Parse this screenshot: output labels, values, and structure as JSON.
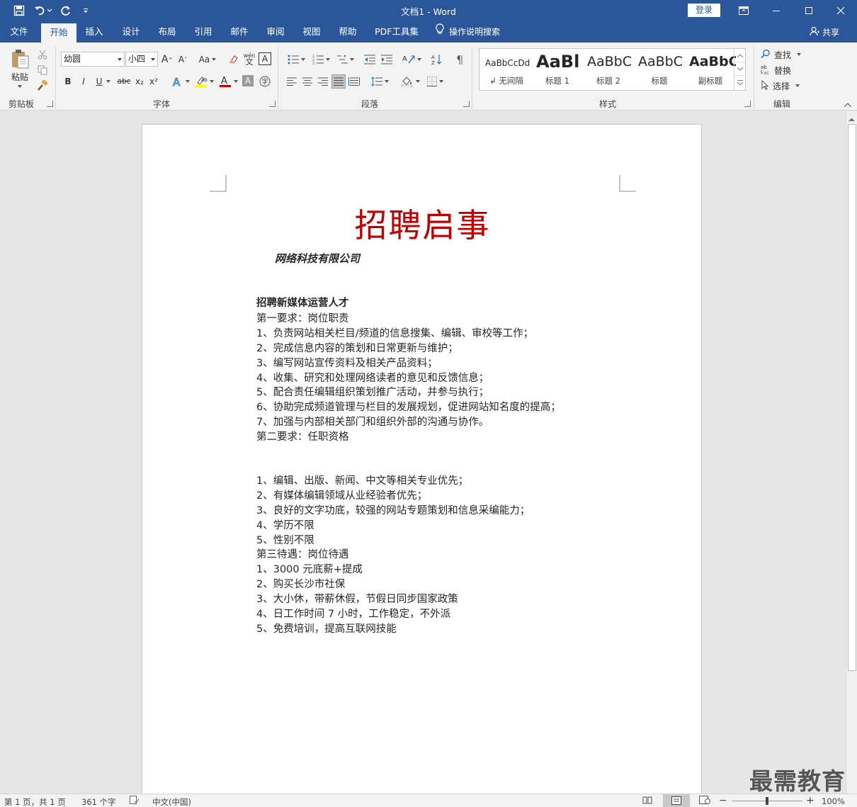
{
  "titlebar": {
    "title": "文档1 - Word",
    "login_label": "登录"
  },
  "tabs": [
    {
      "label": "文件"
    },
    {
      "label": "开始"
    },
    {
      "label": "插入"
    },
    {
      "label": "设计"
    },
    {
      "label": "布局"
    },
    {
      "label": "引用"
    },
    {
      "label": "邮件"
    },
    {
      "label": "审阅"
    },
    {
      "label": "视图"
    },
    {
      "label": "帮助"
    },
    {
      "label": "PDF工具集"
    }
  ],
  "tell_me": "操作说明搜索",
  "share": "共享",
  "ribbon": {
    "clipboard": {
      "paste_label": "粘贴",
      "group_label": "剪贴板"
    },
    "font": {
      "font_name": "幼圆",
      "font_size": "小四",
      "group_label": "字体",
      "bold": "B",
      "italic": "I",
      "underline": "U",
      "strike": "abc",
      "subscript": "x₂",
      "superscript": "x²",
      "grow": "A",
      "shrink": "A",
      "case": "Aa",
      "phonetic": "wén",
      "border_char": "A",
      "shading_char": "A"
    },
    "paragraph": {
      "group_label": "段落"
    },
    "styles": {
      "group_label": "样式",
      "items": [
        {
          "sample": "AaBbCcDd",
          "name": "↲ 无间隔"
        },
        {
          "sample": "AaBl",
          "name": "标题 1"
        },
        {
          "sample": "AaBbC",
          "name": "标题 2"
        },
        {
          "sample": "AaBbC",
          "name": "标题"
        },
        {
          "sample": "AaBbC",
          "name": "副标题"
        }
      ]
    },
    "editing": {
      "group_label": "编辑",
      "find": "查找",
      "replace": "替换",
      "select": "选择"
    }
  },
  "document": {
    "title": "招聘启事",
    "company": "网络科技有限公司",
    "heading": "招聘新媒体运营人才",
    "lines": [
      "第一要求：岗位职责",
      "1、负责网站相关栏目/频道的信息搜集、编辑、审校等工作；",
      "2、完成信息内容的策划和日常更新与维护；",
      "3、编写网站宣传资料及相关产品资料；",
      "4、收集、研究和处理网络读者的意见和反馈信息；",
      "5、配合责任编辑组织策划推广活动，并参与执行；",
      "6、协助完成频道管理与栏目的发展规划，促进网站知名度的提高；",
      "7、加强与内部相关部门和组织外部的沟通与协作。",
      "第二要求：任职资格",
      "",
      "",
      "1、编辑、出版、新闻、中文等相关专业优先；",
      "2、有媒体编辑领域从业经验者优先；",
      "3、良好的文字功底，较强的网站专题策划和信息采编能力；",
      "4、学历不限",
      "5、性别不限",
      "第三待遇：岗位待遇",
      "1、3000 元底薪+提成",
      "2、购买长沙市社保",
      "3、大小休，带薪休假，节假日同步国家政策",
      "4、日工作时间 7 小时，工作稳定，不外派",
      "5、免费培训，提高互联网技能"
    ]
  },
  "statusbar": {
    "page": "第 1 页，共 1 页",
    "words": "361 个字",
    "language": "中文(中国)",
    "zoom": "100%",
    "zoom_minus": "−",
    "zoom_plus": "+"
  },
  "watermark": "最需教育",
  "colors": {
    "brand": "#2b579a",
    "title_red": "#c00000"
  }
}
